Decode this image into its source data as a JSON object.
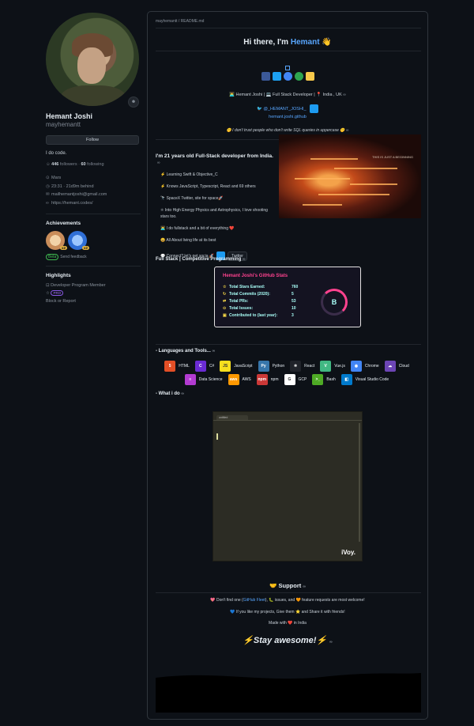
{
  "profile": {
    "name": "Hemant Joshi",
    "username": "mayhemantt",
    "follow_label": "Follow",
    "bio": "I do code.",
    "followers": "446",
    "followers_label": "followers",
    "following": "60",
    "following_label": "following",
    "location": "Mars",
    "time": "23:31 · 21d9m behind",
    "email": "mailhemantjoshi@gmail.com",
    "website": "https://hemant.codes/",
    "achievements_title": "Achievements",
    "achievements": [
      {
        "count": "x2"
      },
      {
        "count": "x2"
      }
    ],
    "beta_pill": "Beta",
    "beta_label": "Send feedback",
    "highlights_title": "Highlights",
    "highlight_1": "Developer Program Member",
    "highlight_2_badge": "PRO",
    "block_label": "Block or Report"
  },
  "readme": {
    "path": "mayhemantt / README.md",
    "hello_prefix": "Hi there, I'm ",
    "hello_name": "Hemant",
    "hello_suffix": " 👋",
    "tagline": "👨‍💻 Hemant Joshi | 💻 Full Stack Developer | 📍 India , UK",
    "twitter_handle": "🐦 @_HEMANT_JOSHI_",
    "site_link": "hemant.joshi.github",
    "quote": "🤫 I don't trust people who don't write SQL queries in uppercase 🤫",
    "intro": "I'm 21 years old Full-Stack developer from India.",
    "list": [
      "⚡ Learning Swift & Objective_C",
      "⚡ Knows JavaScript, Typescript, React and 69 others",
      "🔭 SpaceX Twitter, site for space🚀",
      "⚛ Into High Energy Physics and Astrophysics, I love shooting stars too.",
      "👨‍💻 I do fullstack and a bit of everything ❤️",
      "😄 All About living life at its best"
    ],
    "connect": "💬 Connect? let's get socia 🚀",
    "twitter_label": "Twitter",
    "gif_caption": "THIS IS JUST A BEGINNING",
    "fullstack_heading": "Full Stack | Competitive Programming",
    "stats": {
      "title": "Hemant Joshi's GitHub Stats",
      "rows": [
        {
          "icon": "☆",
          "label": "Total Stars Earned:",
          "value": "760"
        },
        {
          "icon": "↻",
          "label": "Total Commits (2020):",
          "value": "5"
        },
        {
          "icon": "⇄",
          "label": "Total PRs:",
          "value": "53"
        },
        {
          "icon": "⊙",
          "label": "Total Issues:",
          "value": "10"
        },
        {
          "icon": "▣",
          "label": "Contributed to (last year):",
          "value": "3"
        }
      ],
      "rank": "B",
      "rank_progress": 0.5
    },
    "languages_heading": "- Languages and Tools...",
    "tools": [
      {
        "label": "HTML",
        "color": "#e34f26",
        "glyph": "5"
      },
      {
        "label": "C#",
        "color": "#6a2bd3",
        "glyph": "C"
      },
      {
        "label": "JavaScript",
        "color": "#f7df1e",
        "glyph": "JS"
      },
      {
        "label": "Python",
        "color": "#3776ab",
        "glyph": "Py"
      },
      {
        "label": "React",
        "color": "#20232a",
        "glyph": "⚛"
      },
      {
        "label": "Vue.js",
        "color": "#41b883",
        "glyph": "V"
      },
      {
        "label": "Chrome",
        "color": "#4285f4",
        "glyph": "◉"
      },
      {
        "label": "Cloud",
        "color": "#6c45b5",
        "glyph": "☁"
      },
      {
        "label": "Data Science",
        "color": "#b23bd1",
        "glyph": "≡"
      },
      {
        "label": "AWS",
        "color": "#ff9900",
        "glyph": "aws"
      },
      {
        "label": "npm",
        "color": "#cb3837",
        "glyph": "npm"
      },
      {
        "label": "GCP",
        "color": "#ffffff",
        "glyph": "G"
      },
      {
        "label": "Bash",
        "color": "#4eaa25",
        "glyph": ">_"
      },
      {
        "label": "Visual Studio Code",
        "color": "#007acc",
        "glyph": "◧"
      }
    ],
    "whatido_heading": "- What i do",
    "editor_tab": "untitled",
    "editor_brand": "iVoy.",
    "support_heading": "🤝 Support",
    "support_line1_pre": "💖 Don't find one (",
    "support_line1_link": "GitHub Fleet",
    "support_line1_post": "), 🐛 issues, and 🧡 feature requests are most welcome!",
    "support_line2": "💙 If you like my projects, Give them ⭐ and Share it with friends!",
    "made_with": "Made with ❤️ in India",
    "stay": "⚡Stay awesome!⚡"
  },
  "colors": {
    "accent": "#58a6ff",
    "stats_title": "#fe428e",
    "stats_text": "#a9fef7",
    "stats_icon": "#f8d847",
    "social": [
      "#3b5998",
      "#1da1f2",
      "#4285f4",
      "#2ea44f",
      "#f7c94a"
    ]
  }
}
